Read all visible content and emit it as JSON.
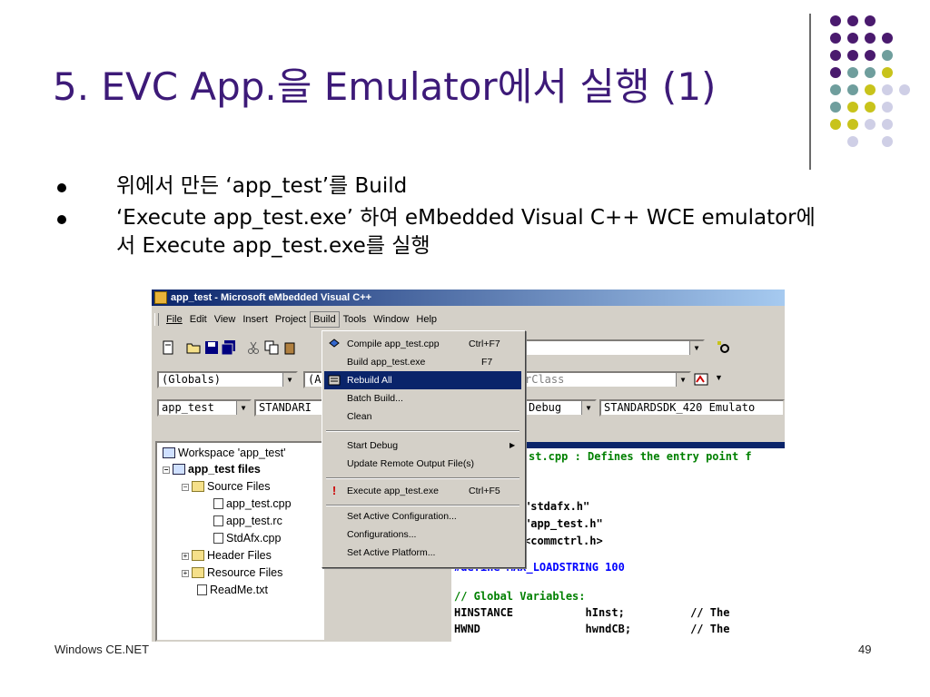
{
  "slide": {
    "title": "5. EVC App.을 Emulator에서 실행 (1)",
    "bullets": [
      "위에서 만든 ‘app_test’를 Build",
      "‘Execute app_test.exe’ 하여 eMbedded Visual C++ WCE emulator에서 Execute app_test.exe를 실행"
    ],
    "footer_left": "Windows CE.NET",
    "page_number": "49"
  },
  "colors": {
    "title": "#3d1a78",
    "dot_purple": "#4a1a6e",
    "dot_teal": "#6f9e9d",
    "dot_yellow": "#c8c31b",
    "dot_lavender": "#cfcfe6"
  },
  "window": {
    "title": "app_test - Microsoft eMbedded Visual C++",
    "menu": [
      "File",
      "Edit",
      "View",
      "Insert",
      "Project",
      "Build",
      "Tools",
      "Window",
      "Help"
    ],
    "active_menu": "Build",
    "combo_globals": "(Globals)",
    "combo_a": "(A",
    "combo_class": "rClass",
    "combo_project": "app_test",
    "combo_sdk_left": "STANDARI",
    "combo_config": "Debug",
    "combo_sdk_right": "STANDARDSDK_420 Emulato"
  },
  "build_menu": {
    "items": [
      {
        "label": "Compile app_test.cpp",
        "accel": "Ctrl+F7"
      },
      {
        "label": "Build app_test.exe",
        "accel": "F7"
      },
      {
        "label": "Rebuild All",
        "accel": ""
      },
      {
        "label": "Batch Build...",
        "accel": ""
      },
      {
        "label": "Clean",
        "accel": ""
      },
      {
        "label": "Start Debug",
        "accel": ""
      },
      {
        "label": "Update Remote Output File(s)",
        "accel": ""
      },
      {
        "label": "Execute app_test.exe",
        "accel": "Ctrl+F5"
      },
      {
        "label": "Set Active Configuration...",
        "accel": ""
      },
      {
        "label": "Configurations...",
        "accel": ""
      },
      {
        "label": "Set Active Platform...",
        "accel": ""
      }
    ],
    "selected": "Rebuild All"
  },
  "workspace_tree": [
    "Workspace 'app_test'",
    "app_test files",
    "Source Files",
    "app_test.cpp",
    "app_test.rc",
    "StdAfx.cpp",
    "Header Files",
    "Resource Files",
    "ReadMe.txt"
  ],
  "code": [
    "st.cpp : Defines the entry point f",
    "\"stdafx.h\"",
    "\"app_test.h\"",
    "<commctrl.h>",
    "#define MAX_LOADSTRING 100",
    "// Global Variables:",
    "HINSTANCE           hInst;          // The",
    "HWND                hwndCB;         // The"
  ]
}
